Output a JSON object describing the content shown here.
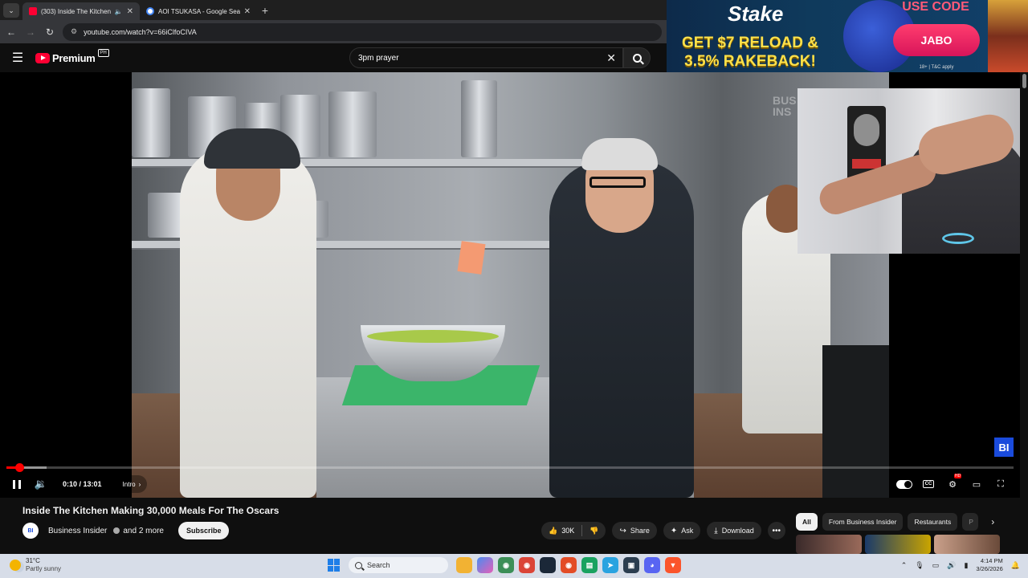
{
  "browser": {
    "tabs": [
      {
        "title": "(303) Inside The Kitchen Ma",
        "active": true,
        "favicon": "youtube-favicon"
      },
      {
        "title": "AOI TSUKASA - Google Search",
        "active": false,
        "favicon": "google-favicon"
      }
    ],
    "url": "youtube.com/watch?v=66iClfoCIVA"
  },
  "youtube": {
    "logo_word": "Premium",
    "country_code": "PH",
    "search_query": "3pm prayer"
  },
  "player": {
    "time": "0:10 / 13:01",
    "chapter": "Intro",
    "played_fraction": 0.013,
    "loaded_fraction": 0.04,
    "channel_bug": "BI",
    "video_watermark": "BUS\nINS"
  },
  "video": {
    "title": "Inside The Kitchen Making 30,000 Meals For The Oscars",
    "channel": "Business Insider",
    "collaborators": "and 2 more",
    "channel_avatar": "BI",
    "subscribe_label": "Subscribe",
    "likes": "30K",
    "share_label": "Share",
    "ask_label": "Ask",
    "download_label": "Download"
  },
  "related_chips": [
    "All",
    "From Business Insider",
    "Restaurants",
    "P"
  ],
  "ad": {
    "brand": "Stake",
    "headline": "GET $7 RELOAD & 3.5% RAKEBACK!",
    "use_code": "USE CODE",
    "code": "JABO",
    "fine_print": "18+ | T&C apply"
  },
  "taskbar": {
    "temperature": "31°C",
    "weather": "Partly sunny",
    "search_label": "Search",
    "time": "4:14 PM",
    "date": "3/26/2026"
  },
  "colors": {
    "accent_red": "#ff0000",
    "youtube_bg": "#0f0f0f",
    "bi_blue": "#1a4bdc"
  }
}
